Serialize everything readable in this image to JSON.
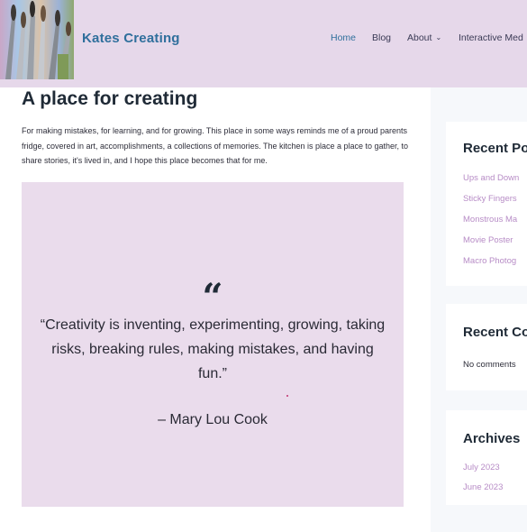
{
  "header": {
    "site_title": "Kates Creating",
    "nav": [
      {
        "label": "Home",
        "active": true,
        "dropdown": false
      },
      {
        "label": "Blog",
        "active": false,
        "dropdown": false
      },
      {
        "label": "About",
        "active": false,
        "dropdown": true
      },
      {
        "label": "Interactive Med",
        "active": false,
        "dropdown": false
      }
    ]
  },
  "main": {
    "title": "A place for creating",
    "intro": "For making mistakes, for learning, and for growing. This place in some ways reminds me of a proud parents fridge, covered in art, accomplishments, a collections of memories. The kitchen is place a place to gather, to share stories, it's lived in, and I hope this place becomes that for me.",
    "quote_mark": "“",
    "quote": "“Creativity is inventing, experimenting, growing, taking risks, breaking rules, making mistakes, and having fun.”",
    "author": "– Mary Lou Cook"
  },
  "sidebar": {
    "recent_posts": {
      "title": "Recent Po",
      "items": [
        "Ups and Down",
        "Sticky Fingers",
        "Monstrous Ma",
        "Movie Poster",
        "Macro Photog"
      ]
    },
    "recent_comments": {
      "title": "Recent Co",
      "text": "No comments"
    },
    "archives": {
      "title": "Archives",
      "items": [
        "July 2023",
        "June 2023"
      ]
    }
  },
  "colors": {
    "header_bg": "#e6d8ea",
    "quote_bg": "#eadcec",
    "accent": "#2f6f9c",
    "link": "#b78cc6"
  }
}
